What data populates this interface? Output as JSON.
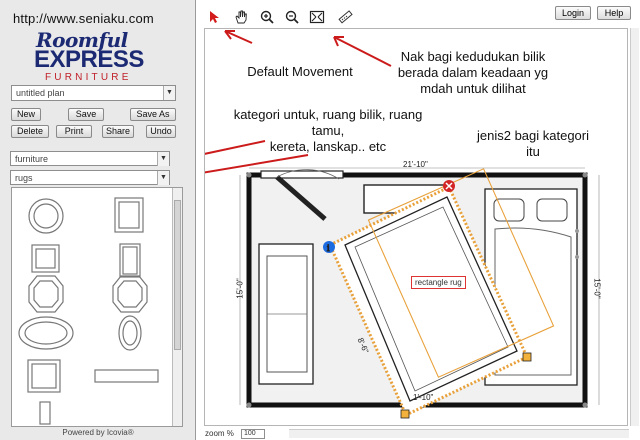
{
  "sidebar": {
    "url_text": "http://www.seniaku.com",
    "logo": {
      "line1": "Roomful",
      "line2": "EXPRESS",
      "line3": "FURNITURE"
    },
    "plan_select_value": "untitled plan",
    "buttons": {
      "new": "New",
      "save": "Save",
      "save_as": "Save As",
      "delete": "Delete",
      "print": "Print",
      "share": "Share",
      "undo": "Undo"
    },
    "category_value": "furniture",
    "subcategory_value": "rugs",
    "powered_by": "Powered by Icovia®"
  },
  "header": {
    "login": "Login",
    "help": "Help"
  },
  "toolbar": {
    "tools": [
      "pointer-icon",
      "hand-pan-icon",
      "zoom-in-icon",
      "zoom-out-icon",
      "fit-to-screen-icon",
      "measure-ruler-icon"
    ]
  },
  "canvas": {
    "rug_label": "rectangle rug",
    "dim_top": "21'-10\"",
    "dim_left": "15'-0\"",
    "dim_right": "15'-0\"",
    "dim_rug": "8'-6\"",
    "dim_bottom": "1'-10\""
  },
  "zoom": {
    "label": "zoom %",
    "value": "100"
  },
  "annotations": {
    "default_movement": "Default Movement",
    "room_view": "Nak bagi kedudukan bilik\nberada dalam keadaan yg\nmdah untuk dilihat",
    "categories": "kategori untuk, ruang bilik, ruang tamu,\nkereta, lanskap.. etc",
    "sub_types": "jenis2 bagi kategori\nitu"
  },
  "colors": {
    "arrow": "#cc1b1b",
    "brand_blue": "#1c2a74",
    "brand_red": "#c0202a",
    "rug_stroke": "#e8a13a"
  }
}
